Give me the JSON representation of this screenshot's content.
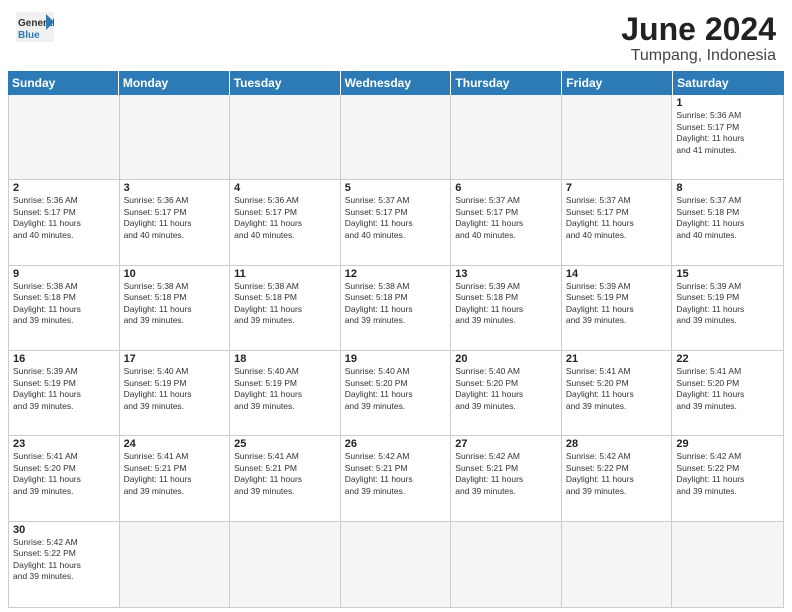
{
  "header": {
    "logo_general": "General",
    "logo_blue": "Blue",
    "month_year": "June 2024",
    "location": "Tumpang, Indonesia"
  },
  "weekdays": [
    "Sunday",
    "Monday",
    "Tuesday",
    "Wednesday",
    "Thursday",
    "Friday",
    "Saturday"
  ],
  "rows": [
    [
      {
        "day": "",
        "info": "",
        "empty": true
      },
      {
        "day": "",
        "info": "",
        "empty": true
      },
      {
        "day": "",
        "info": "",
        "empty": true
      },
      {
        "day": "",
        "info": "",
        "empty": true
      },
      {
        "day": "",
        "info": "",
        "empty": true
      },
      {
        "day": "",
        "info": "",
        "empty": true
      },
      {
        "day": "1",
        "info": "Sunrise: 5:36 AM\nSunset: 5:17 PM\nDaylight: 11 hours\nand 41 minutes.",
        "empty": false
      }
    ],
    [
      {
        "day": "2",
        "info": "Sunrise: 5:36 AM\nSunset: 5:17 PM\nDaylight: 11 hours\nand 40 minutes."
      },
      {
        "day": "3",
        "info": "Sunrise: 5:36 AM\nSunset: 5:17 PM\nDaylight: 11 hours\nand 40 minutes."
      },
      {
        "day": "4",
        "info": "Sunrise: 5:36 AM\nSunset: 5:17 PM\nDaylight: 11 hours\nand 40 minutes."
      },
      {
        "day": "5",
        "info": "Sunrise: 5:37 AM\nSunset: 5:17 PM\nDaylight: 11 hours\nand 40 minutes."
      },
      {
        "day": "6",
        "info": "Sunrise: 5:37 AM\nSunset: 5:17 PM\nDaylight: 11 hours\nand 40 minutes."
      },
      {
        "day": "7",
        "info": "Sunrise: 5:37 AM\nSunset: 5:17 PM\nDaylight: 11 hours\nand 40 minutes."
      },
      {
        "day": "8",
        "info": "Sunrise: 5:37 AM\nSunset: 5:18 PM\nDaylight: 11 hours\nand 40 minutes."
      }
    ],
    [
      {
        "day": "9",
        "info": "Sunrise: 5:38 AM\nSunset: 5:18 PM\nDaylight: 11 hours\nand 39 minutes."
      },
      {
        "day": "10",
        "info": "Sunrise: 5:38 AM\nSunset: 5:18 PM\nDaylight: 11 hours\nand 39 minutes."
      },
      {
        "day": "11",
        "info": "Sunrise: 5:38 AM\nSunset: 5:18 PM\nDaylight: 11 hours\nand 39 minutes."
      },
      {
        "day": "12",
        "info": "Sunrise: 5:38 AM\nSunset: 5:18 PM\nDaylight: 11 hours\nand 39 minutes."
      },
      {
        "day": "13",
        "info": "Sunrise: 5:39 AM\nSunset: 5:18 PM\nDaylight: 11 hours\nand 39 minutes."
      },
      {
        "day": "14",
        "info": "Sunrise: 5:39 AM\nSunset: 5:19 PM\nDaylight: 11 hours\nand 39 minutes."
      },
      {
        "day": "15",
        "info": "Sunrise: 5:39 AM\nSunset: 5:19 PM\nDaylight: 11 hours\nand 39 minutes."
      }
    ],
    [
      {
        "day": "16",
        "info": "Sunrise: 5:39 AM\nSunset: 5:19 PM\nDaylight: 11 hours\nand 39 minutes."
      },
      {
        "day": "17",
        "info": "Sunrise: 5:40 AM\nSunset: 5:19 PM\nDaylight: 11 hours\nand 39 minutes."
      },
      {
        "day": "18",
        "info": "Sunrise: 5:40 AM\nSunset: 5:19 PM\nDaylight: 11 hours\nand 39 minutes."
      },
      {
        "day": "19",
        "info": "Sunrise: 5:40 AM\nSunset: 5:20 PM\nDaylight: 11 hours\nand 39 minutes."
      },
      {
        "day": "20",
        "info": "Sunrise: 5:40 AM\nSunset: 5:20 PM\nDaylight: 11 hours\nand 39 minutes."
      },
      {
        "day": "21",
        "info": "Sunrise: 5:41 AM\nSunset: 5:20 PM\nDaylight: 11 hours\nand 39 minutes."
      },
      {
        "day": "22",
        "info": "Sunrise: 5:41 AM\nSunset: 5:20 PM\nDaylight: 11 hours\nand 39 minutes."
      }
    ],
    [
      {
        "day": "23",
        "info": "Sunrise: 5:41 AM\nSunset: 5:20 PM\nDaylight: 11 hours\nand 39 minutes."
      },
      {
        "day": "24",
        "info": "Sunrise: 5:41 AM\nSunset: 5:21 PM\nDaylight: 11 hours\nand 39 minutes."
      },
      {
        "day": "25",
        "info": "Sunrise: 5:41 AM\nSunset: 5:21 PM\nDaylight: 11 hours\nand 39 minutes."
      },
      {
        "day": "26",
        "info": "Sunrise: 5:42 AM\nSunset: 5:21 PM\nDaylight: 11 hours\nand 39 minutes."
      },
      {
        "day": "27",
        "info": "Sunrise: 5:42 AM\nSunset: 5:21 PM\nDaylight: 11 hours\nand 39 minutes."
      },
      {
        "day": "28",
        "info": "Sunrise: 5:42 AM\nSunset: 5:22 PM\nDaylight: 11 hours\nand 39 minutes."
      },
      {
        "day": "29",
        "info": "Sunrise: 5:42 AM\nSunset: 5:22 PM\nDaylight: 11 hours\nand 39 minutes."
      }
    ],
    [
      {
        "day": "30",
        "info": "Sunrise: 5:42 AM\nSunset: 5:22 PM\nDaylight: 11 hours\nand 39 minutes."
      },
      {
        "day": "",
        "info": "",
        "empty": true
      },
      {
        "day": "",
        "info": "",
        "empty": true
      },
      {
        "day": "",
        "info": "",
        "empty": true
      },
      {
        "day": "",
        "info": "",
        "empty": true
      },
      {
        "day": "",
        "info": "",
        "empty": true
      },
      {
        "day": "",
        "info": "",
        "empty": true
      }
    ]
  ]
}
